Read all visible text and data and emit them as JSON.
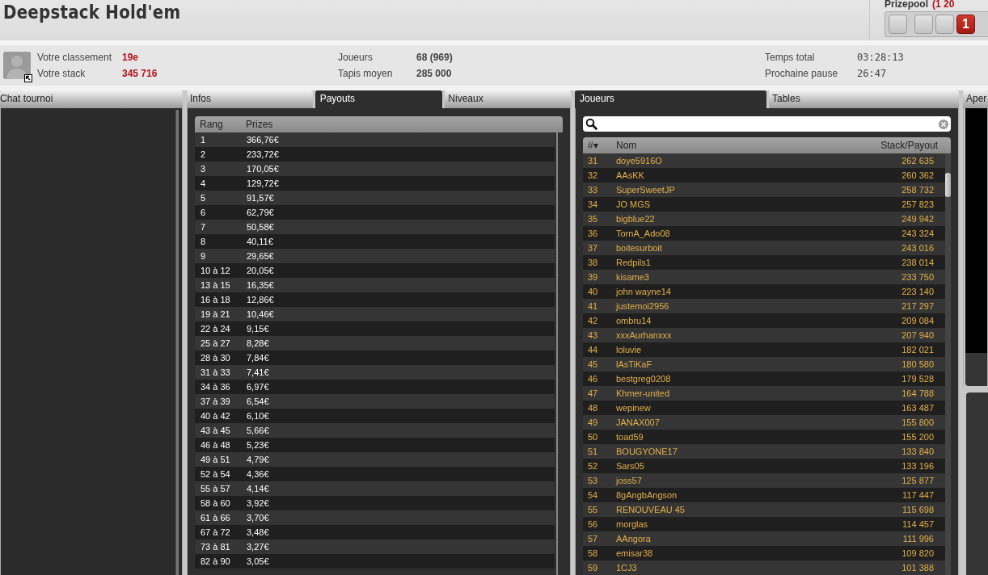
{
  "title": "Deepstack Hold'em",
  "prizepool": {
    "label": "Prizepool",
    "amount": "(1 20"
  },
  "counter_digits": [
    {
      "lit": false
    },
    {
      "lit": false
    },
    {
      "lit": false
    },
    {
      "lit": true,
      "digit": "1"
    }
  ],
  "stat_groups": [
    [
      {
        "label": "Votre classement",
        "value": "19e",
        "kind": "highlight"
      },
      {
        "label": "Votre stack",
        "value": "345 716",
        "kind": "highlight"
      }
    ],
    [
      {
        "label": "Joueurs",
        "value": "68 (969)",
        "kind": "plain"
      },
      {
        "label": "Tapis moyen",
        "value": "285 000",
        "kind": "plain"
      }
    ],
    [
      {
        "label": "Temps total",
        "value": "03:28:13",
        "kind": "digital"
      },
      {
        "label": "Prochaine pause",
        "value": "26:47",
        "kind": "digital"
      }
    ]
  ],
  "chat_panel": {
    "tabs": [
      {
        "label": "Chat tournoi",
        "selected": false
      }
    ]
  },
  "payouts_panel": {
    "tabs": [
      {
        "label": "Infos",
        "selected": false
      },
      {
        "label": "Payouts",
        "selected": true
      },
      {
        "label": "Niveaux",
        "selected": false
      }
    ],
    "columns": [
      "Rang",
      "Prizes"
    ],
    "rows": [
      [
        "1",
        "366,76€"
      ],
      [
        "2",
        "233,72€"
      ],
      [
        "3",
        "170,05€"
      ],
      [
        "4",
        "129,72€"
      ],
      [
        "5",
        "91,57€"
      ],
      [
        "6",
        "62,79€"
      ],
      [
        "7",
        "50,58€"
      ],
      [
        "8",
        "40,11€"
      ],
      [
        "9",
        "29,65€"
      ],
      [
        "10 à 12",
        "20,05€"
      ],
      [
        "13 à 15",
        "16,35€"
      ],
      [
        "16 à 18",
        "12,86€"
      ],
      [
        "19 à 21",
        "10,46€"
      ],
      [
        "22 à 24",
        "9,15€"
      ],
      [
        "25 à 27",
        "8,28€"
      ],
      [
        "28 à 30",
        "7,84€"
      ],
      [
        "31 à 33",
        "7,41€"
      ],
      [
        "34 à 36",
        "6,97€"
      ],
      [
        "37 à 39",
        "6,54€"
      ],
      [
        "40 à 42",
        "6,10€"
      ],
      [
        "43 à 45",
        "5,66€"
      ],
      [
        "46 à 48",
        "5,23€"
      ],
      [
        "49 à 51",
        "4,79€"
      ],
      [
        "52 à 54",
        "4,36€"
      ],
      [
        "55 à 57",
        "4,14€"
      ],
      [
        "58 à 60",
        "3,92€"
      ],
      [
        "61 à 66",
        "3,70€"
      ],
      [
        "67 à 72",
        "3,48€"
      ],
      [
        "73 à 81",
        "3,27€"
      ],
      [
        "82 à 90",
        "3,05€"
      ]
    ]
  },
  "players_panel": {
    "tabs": [
      {
        "label": "Joueurs",
        "selected": true
      },
      {
        "label": "Tables",
        "selected": false
      }
    ],
    "columns": [
      "#▾",
      "Nom",
      "Stack/Payout"
    ],
    "rows": [
      [
        "31",
        "doye5916O",
        "262 635"
      ],
      [
        "32",
        "AAsKK",
        "260 362"
      ],
      [
        "33",
        "SuperSweetJP",
        "258 732"
      ],
      [
        "34",
        "JO MGS",
        "257 823"
      ],
      [
        "35",
        "bigblue22",
        "249 942"
      ],
      [
        "36",
        "TornA_Ado08",
        "243 324"
      ],
      [
        "37",
        "boitesurboit",
        "243 016"
      ],
      [
        "38",
        "Redpils1",
        "238 014"
      ],
      [
        "39",
        "kisame3",
        "233 750"
      ],
      [
        "40",
        "john wayne14",
        "223 140"
      ],
      [
        "41",
        "justemoi2956",
        "217 297"
      ],
      [
        "42",
        "ombru14",
        "209 084"
      ],
      [
        "43",
        "xxxAurhanxxx",
        "207 940"
      ],
      [
        "44",
        "loluvie",
        "182 021"
      ],
      [
        "45",
        "lAsTiKaF",
        "180 580"
      ],
      [
        "46",
        "bestgreg0208",
        "179 528"
      ],
      [
        "47",
        "Khmer-united",
        "164 788"
      ],
      [
        "48",
        "wepinew",
        "163 487"
      ],
      [
        "49",
        "JANAX007",
        "155 800"
      ],
      [
        "50",
        "toad59",
        "155 200"
      ],
      [
        "51",
        "BOUGYONE17",
        "133 840"
      ],
      [
        "52",
        "Sars05",
        "133 196"
      ],
      [
        "53",
        "joss57",
        "125 877"
      ],
      [
        "54",
        "8gAngbAngson",
        "117 447"
      ],
      [
        "55",
        "RENOUVEAU 45",
        "115 698"
      ],
      [
        "56",
        "morglas",
        "114 457"
      ],
      [
        "57",
        "AAngora",
        "111 996"
      ],
      [
        "58",
        "emisar38",
        "109 820"
      ],
      [
        "59",
        "1CJ3",
        "101 388"
      ]
    ]
  },
  "preview_panel": {
    "tabs": [
      {
        "label": "Aper",
        "selected": false
      }
    ]
  }
}
